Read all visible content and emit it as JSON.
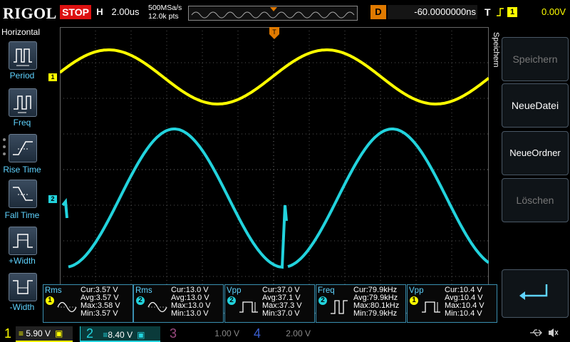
{
  "topbar": {
    "logo": "RIGOL",
    "run_state": "STOP",
    "horizontal_label": "H",
    "timebase": "2.00us",
    "sample_rate": "500MSa/s",
    "memory_depth": "12.0k pts",
    "delay_label": "D",
    "delay": "-60.0000000ns",
    "trigger_label": "T",
    "trigger_source": "1",
    "trigger_level": "0.00V"
  },
  "left_panel": {
    "title": "Horizontal",
    "items": [
      {
        "label": "Period",
        "icon": "period-icon"
      },
      {
        "label": "Freq",
        "icon": "freq-icon"
      },
      {
        "label": "Rise Time",
        "icon": "rise-time-icon"
      },
      {
        "label": "Fall Time",
        "icon": "fall-time-icon"
      },
      {
        "label": "+Width",
        "icon": "pos-width-icon"
      },
      {
        "label": "-Width",
        "icon": "neg-width-icon"
      }
    ]
  },
  "right_panel": {
    "title": "Speichern",
    "buttons": [
      {
        "label": "Speichern",
        "enabled": false
      },
      {
        "label": "NeueDatei",
        "enabled": true
      },
      {
        "label": "NeueOrdner",
        "enabled": true
      },
      {
        "label": "Löschen",
        "enabled": false
      },
      {
        "label": "enter-icon",
        "enabled": true
      }
    ]
  },
  "channels": {
    "ch1": {
      "marker": "1",
      "color": "#ffff00"
    },
    "ch2": {
      "marker": "2",
      "color": "#22d3dd"
    }
  },
  "measurements": [
    {
      "name": "Rms",
      "ch": "1",
      "cur": "Cur:3.57 V",
      "avg": "Avg:3.57 V",
      "max": "Max:3.58 V",
      "min": "Min:3.57 V"
    },
    {
      "name": "Rms",
      "ch": "2",
      "cur": "Cur:13.0 V",
      "avg": "Avg:13.0 V",
      "max": "Max:13.0 V",
      "min": "Min:13.0 V"
    },
    {
      "name": "Vpp",
      "ch": "2",
      "cur": "Cur:37.0 V",
      "avg": "Avg:37.1 V",
      "max": "Max:37.3 V",
      "min": "Min:37.0 V"
    },
    {
      "name": "Freq",
      "ch": "2",
      "cur": "Cur:79.9kHz",
      "avg": "Avg:79.9kHz",
      "max": "Max:80.1kHz",
      "min": "Min:79.9kHz"
    },
    {
      "name": "Vpp",
      "ch": "1",
      "cur": "Cur:10.4 V",
      "avg": "Avg:10.4 V",
      "max": "Max:10.4 V",
      "min": "Min:10.4 V"
    }
  ],
  "bottombar": {
    "ch1": {
      "num": "1",
      "scale": "5.90 V",
      "color": "#ffff00"
    },
    "ch2": {
      "num": "2",
      "scale": "8.40 V",
      "color": "#22d3dd"
    },
    "ch3": {
      "num": "3",
      "scale": "1.00 V",
      "color": "#c0509a"
    },
    "ch4": {
      "num": "4",
      "scale": "2.00 V",
      "color": "#3a5fd0"
    }
  }
}
